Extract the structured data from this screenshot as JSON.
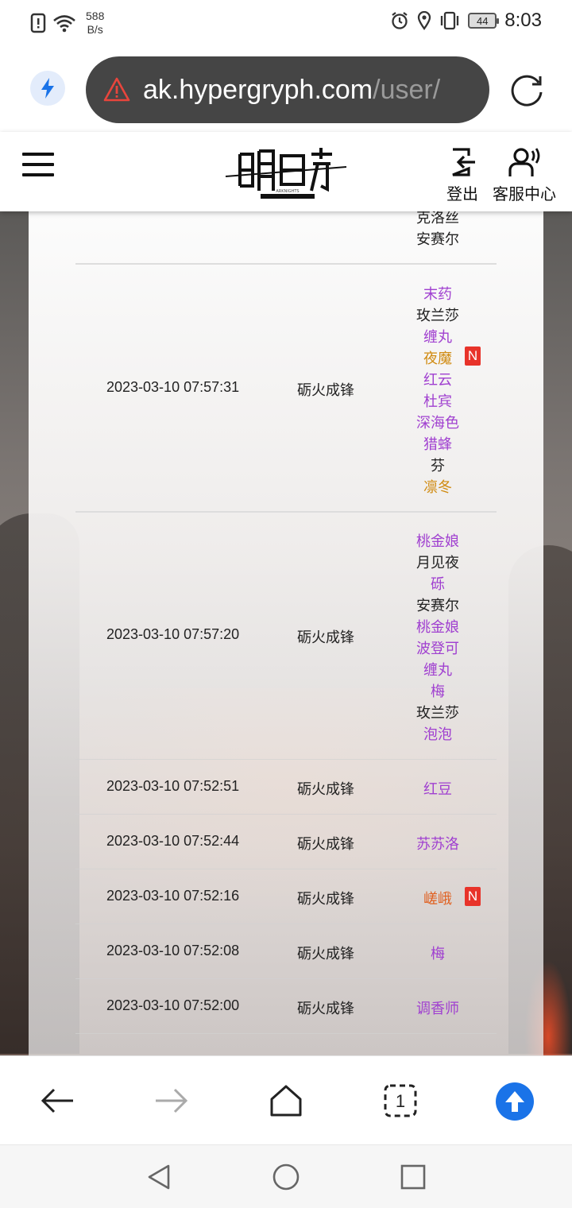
{
  "status_bar": {
    "network_speed_value": "588",
    "network_speed_unit": "B/s",
    "battery": "44",
    "time": "8:03"
  },
  "browser": {
    "url_host": "ak.hypergryph.com",
    "url_path": "/user/"
  },
  "site_header": {
    "logout_label": "登出",
    "support_label": "客服中心"
  },
  "records": {
    "partial_top": [
      "克洛丝",
      "安赛尔"
    ],
    "rows": [
      {
        "time": "2023-03-10 07:57:31",
        "pool": "砺火成锋",
        "characters": [
          {
            "name": "末药",
            "color": "#a040d0",
            "new": false
          },
          {
            "name": "玫兰莎",
            "color": "#222222",
            "new": false
          },
          {
            "name": "缠丸",
            "color": "#a040d0",
            "new": false
          },
          {
            "name": "夜魔",
            "color": "#d08a10",
            "new": true
          },
          {
            "name": "红云",
            "color": "#a040d0",
            "new": false
          },
          {
            "name": "杜宾",
            "color": "#a040d0",
            "new": false
          },
          {
            "name": "深海色",
            "color": "#a040d0",
            "new": false
          },
          {
            "name": "猎蜂",
            "color": "#a040d0",
            "new": false
          },
          {
            "name": "芬",
            "color": "#222222",
            "new": false
          },
          {
            "name": "凛冬",
            "color": "#d08a10",
            "new": false
          }
        ]
      },
      {
        "time": "2023-03-10 07:57:20",
        "pool": "砺火成锋",
        "characters": [
          {
            "name": "桃金娘",
            "color": "#a040d0",
            "new": false
          },
          {
            "name": "月见夜",
            "color": "#222222",
            "new": false
          },
          {
            "name": "砾",
            "color": "#a040d0",
            "new": false
          },
          {
            "name": "安赛尔",
            "color": "#222222",
            "new": false
          },
          {
            "name": "桃金娘",
            "color": "#a040d0",
            "new": false
          },
          {
            "name": "波登可",
            "color": "#a040d0",
            "new": false
          },
          {
            "name": "缠丸",
            "color": "#a040d0",
            "new": false
          },
          {
            "name": "梅",
            "color": "#a040d0",
            "new": false
          },
          {
            "name": "玫兰莎",
            "color": "#222222",
            "new": false
          },
          {
            "name": "泡泡",
            "color": "#a040d0",
            "new": false
          }
        ]
      },
      {
        "time": "2023-03-10 07:52:51",
        "pool": "砺火成锋",
        "characters": [
          {
            "name": "红豆",
            "color": "#a040d0",
            "new": false
          }
        ]
      },
      {
        "time": "2023-03-10 07:52:44",
        "pool": "砺火成锋",
        "characters": [
          {
            "name": "苏苏洛",
            "color": "#a040d0",
            "new": false
          }
        ]
      },
      {
        "time": "2023-03-10 07:52:16",
        "pool": "砺火成锋",
        "characters": [
          {
            "name": "嵯峨",
            "color": "#e06020",
            "new": true
          }
        ]
      },
      {
        "time": "2023-03-10 07:52:08",
        "pool": "砺火成锋",
        "characters": [
          {
            "name": "梅",
            "color": "#a040d0",
            "new": false
          }
        ]
      },
      {
        "time": "2023-03-10 07:52:00",
        "pool": "砺火成锋",
        "characters": [
          {
            "name": "调香师",
            "color": "#a040d0",
            "new": false
          }
        ]
      }
    ],
    "new_badge": "N"
  },
  "bottom_toolbar": {
    "tab_count": "1"
  }
}
